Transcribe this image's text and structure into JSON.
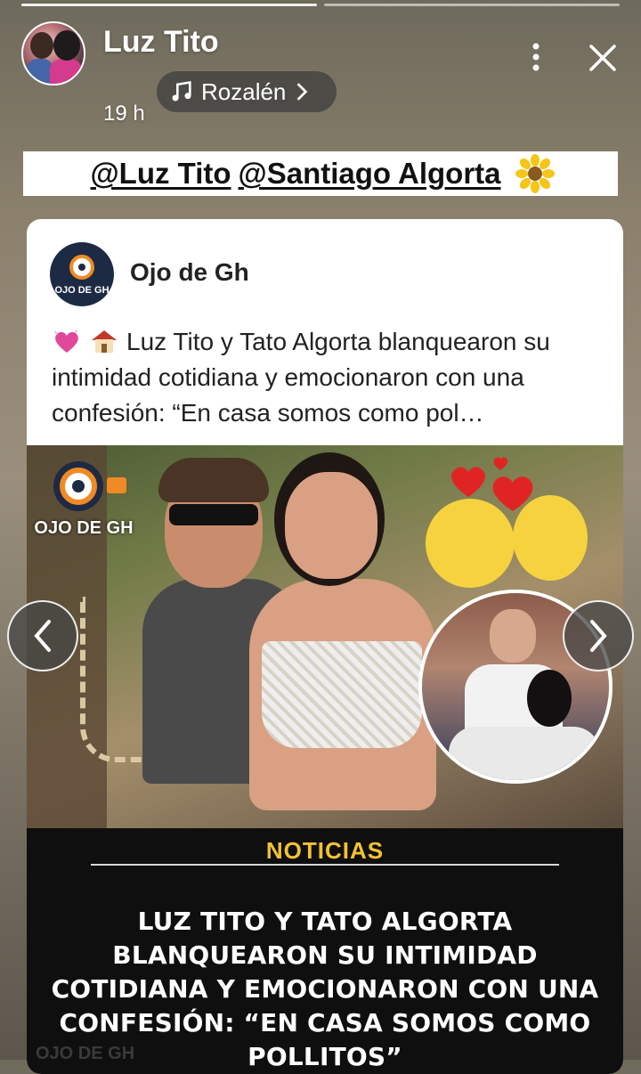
{
  "story": {
    "username": "Luz Tito",
    "time": "19 h",
    "music": "Rozalén",
    "mentions": [
      "@Luz Tito",
      "@Santiago Algorta"
    ],
    "sticker_icon": "sunflower-icon"
  },
  "post": {
    "page_name": "Ojo de Gh",
    "logo_text": "OJO DE GH",
    "text": "Luz Tito y Tato Algorta blanquearon su intimidad cotidiana y emocionaron con una confesión: “En casa somos como pol…",
    "leading_icons": [
      "sparkling-heart-icon",
      "house-icon"
    ],
    "photo_logo_text": "OJO DE GH",
    "news_label": "NOTICIAS",
    "headline": "LUZ TITO Y TATO ALGORTA BLANQUEARON SU INTIMIDAD COTIDIANA Y EMOCIONARON CON UNA CONFESIÓN: “EN CASA SOMOS COMO POLLITOS”",
    "watermark": "OJO DE GH"
  },
  "colors": {
    "news_label": "#f2c233",
    "news_bg": "#0f0f0f"
  }
}
